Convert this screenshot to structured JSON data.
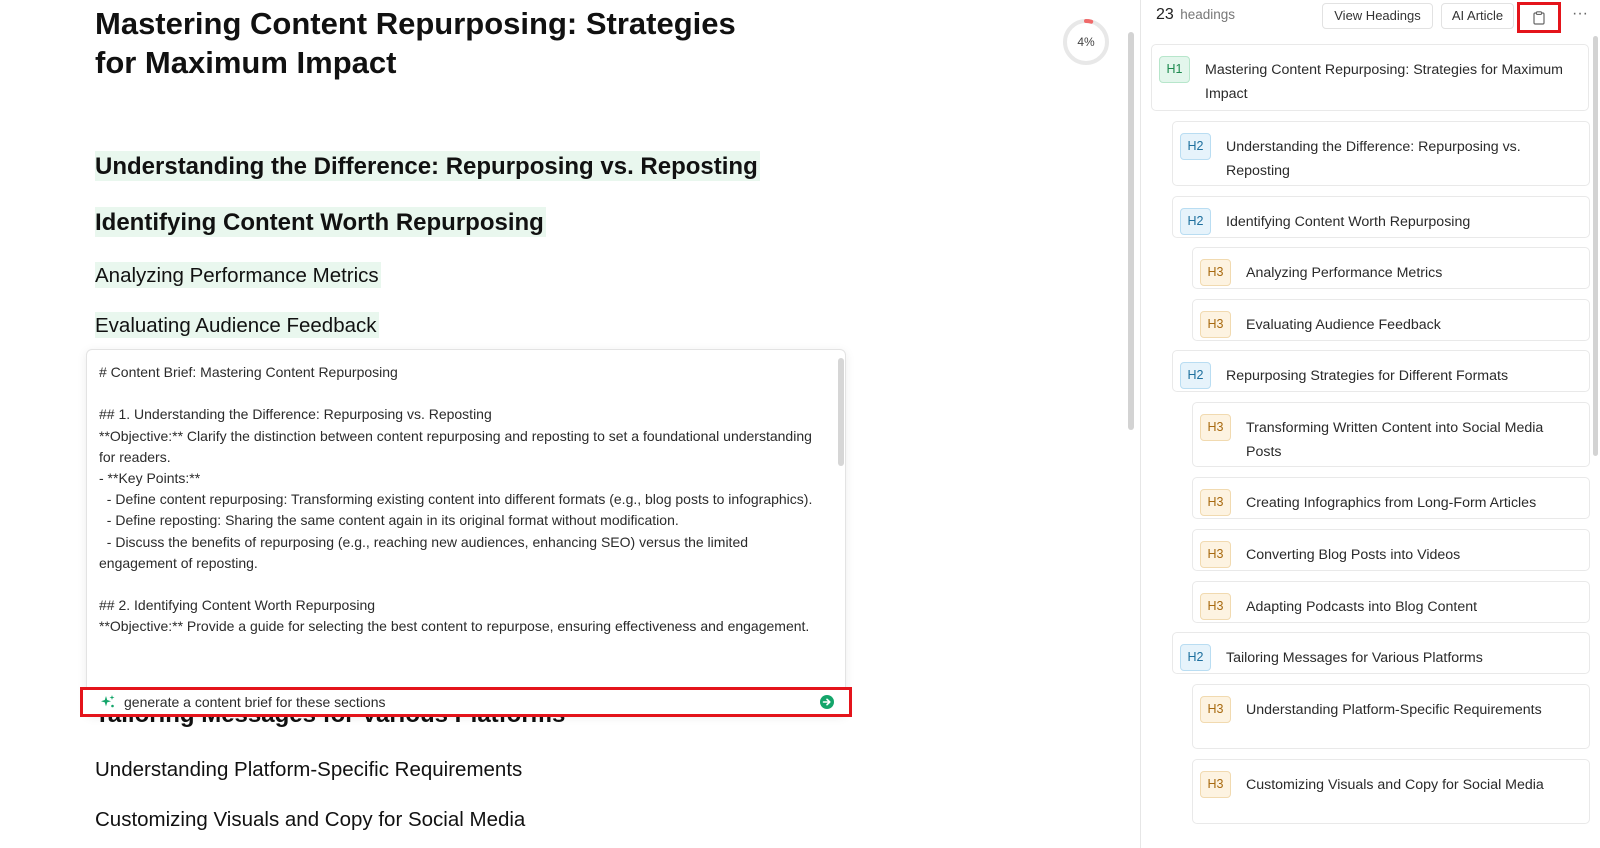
{
  "document": {
    "title": "Mastering Content Repurposing: Strategies for Maximum Impact",
    "progress": "4%",
    "progress_fraction": 0.04,
    "headings": {
      "h2_difference": "Understanding the Difference: Repurposing vs. Reposting",
      "h2_identifying": "Identifying Content Worth Repurposing",
      "h3_performance": "Analyzing Performance Metrics",
      "h3_feedback": "Evaluating Audience Feedback",
      "h2_tailoring": "Tailoring Messages for Various Platforms",
      "h3_platform": "Understanding Platform-Specific Requirements",
      "h3_visuals": "Customizing Visuals and Copy for Social Media"
    }
  },
  "brief": {
    "text": "# Content Brief: Mastering Content Repurposing\n\n## 1. Understanding the Difference: Repurposing vs. Reposting\n**Objective:** Clarify the distinction between content repurposing and reposting to set a foundational understanding for readers.\n- **Key Points:**\n  - Define content repurposing: Transforming existing content into different formats (e.g., blog posts to infographics).\n  - Define reposting: Sharing the same content again in its original format without modification.\n  - Discuss the benefits of repurposing (e.g., reaching new audiences, enhancing SEO) versus the limited engagement of reposting.\n\n## 2. Identifying Content Worth Repurposing\n**Objective:** Provide a guide for selecting the best content to repurpose, ensuring effectiveness and engagement.",
    "prompt": "generate a content brief for these sections"
  },
  "panel": {
    "count": "23",
    "count_label": "headings",
    "view_headings": "View Headings",
    "ai_article": "AI Article",
    "more": "···",
    "items": [
      {
        "level": "H1",
        "text": "Mastering Content Repurposing: Strategies for Maximum Impact"
      },
      {
        "level": "H2",
        "text": "Understanding the Difference: Repurposing vs. Reposting"
      },
      {
        "level": "H2",
        "text": "Identifying Content Worth Repurposing"
      },
      {
        "level": "H3",
        "text": "Analyzing Performance Metrics"
      },
      {
        "level": "H3",
        "text": "Evaluating Audience Feedback"
      },
      {
        "level": "H2",
        "text": "Repurposing Strategies for Different Formats"
      },
      {
        "level": "H3",
        "text": "Transforming Written Content into Social Media Posts"
      },
      {
        "level": "H3",
        "text": "Creating Infographics from Long-Form Articles"
      },
      {
        "level": "H3",
        "text": "Converting Blog Posts into Videos"
      },
      {
        "level": "H3",
        "text": "Adapting Podcasts into Blog Content"
      },
      {
        "level": "H2",
        "text": "Tailoring Messages for Various Platforms"
      },
      {
        "level": "H3",
        "text": "Understanding Platform-Specific Requirements"
      },
      {
        "level": "H3",
        "text": "Customizing Visuals and Copy for Social Media"
      }
    ]
  },
  "colors": {
    "highlight": "#e9f7ee",
    "annotation_red": "#e4141b",
    "accent_green": "#14a56a",
    "progress_red": "#f06a6a"
  },
  "icons": {
    "copy": "clipboard-icon",
    "prompt": "sparkle-icon",
    "send": "arrow-right-circle-icon"
  }
}
